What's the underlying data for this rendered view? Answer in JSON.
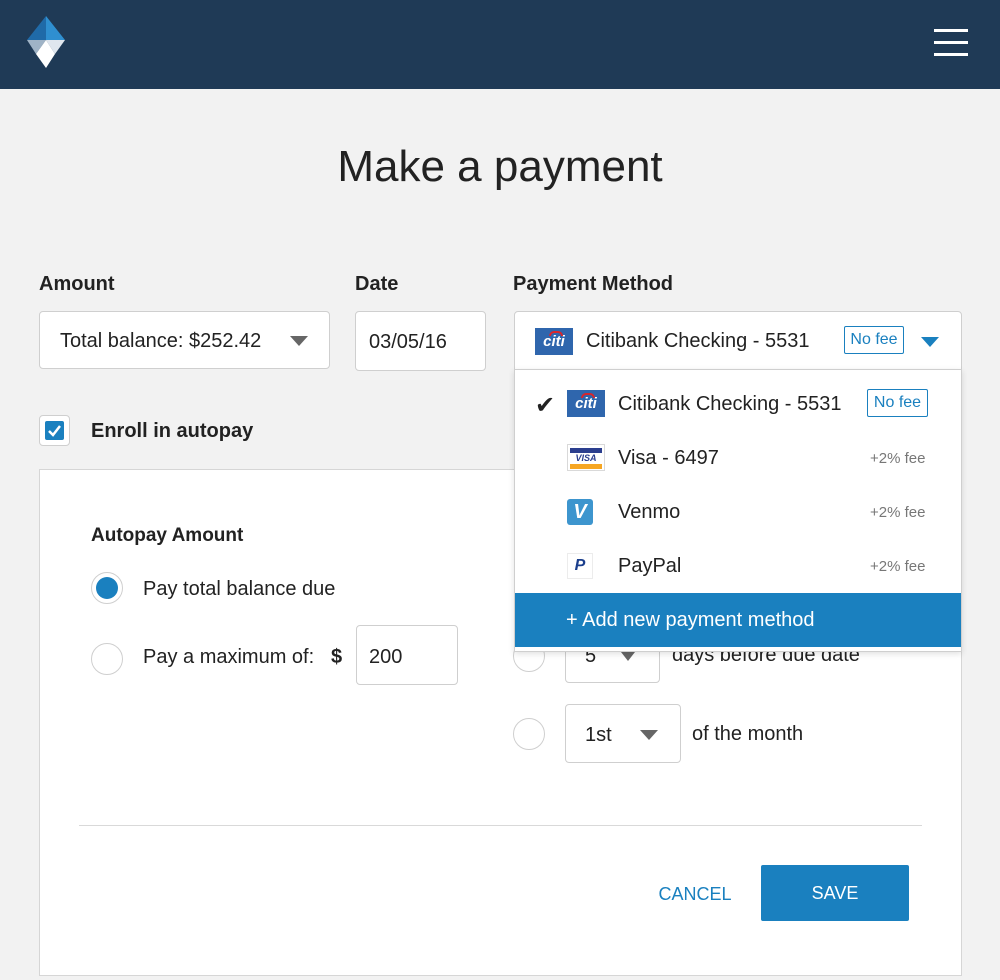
{
  "header": {
    "logo_icon": "diamond-logo-icon",
    "menu_icon": "hamburger-menu-icon",
    "bg_color": "#1f3a56"
  },
  "page_title": "Make a payment",
  "amount": {
    "label": "Amount",
    "value": "Total balance: $252.42"
  },
  "date": {
    "label": "Date",
    "value": "03/05/16"
  },
  "payment_method": {
    "label": "Payment Method",
    "selected": "Citibank Checking - 5531",
    "selected_badge": "No fee",
    "options": [
      {
        "label": "Citibank Checking - 5531",
        "fee": "No fee",
        "icon": "citi-logo-icon",
        "checked": true
      },
      {
        "label": "Visa - 6497",
        "fee": "+2% fee",
        "icon": "visa-card-icon",
        "checked": false
      },
      {
        "label": "Venmo",
        "fee": "+2% fee",
        "icon": "venmo-logo-icon",
        "checked": false
      },
      {
        "label": "PayPal",
        "fee": "+2% fee",
        "icon": "paypal-logo-icon",
        "checked": false
      }
    ],
    "add_new": "+ Add new payment method"
  },
  "autopay": {
    "enroll_label": "Enroll in autopay",
    "enrolled": true,
    "amount_heading": "Autopay Amount",
    "options": {
      "total": "Pay total balance due",
      "maximum": "Pay a maximum of:",
      "currency": "$",
      "maximum_value": "200"
    },
    "date_options": {
      "days_value": "5",
      "days_label": "days before due date",
      "day_of_month_value": "1st",
      "day_of_month_label": "of the month"
    }
  },
  "actions": {
    "cancel": "CANCEL",
    "save": "SAVE"
  },
  "colors": {
    "accent": "#1a80bf",
    "background": "#f2f2f2"
  }
}
